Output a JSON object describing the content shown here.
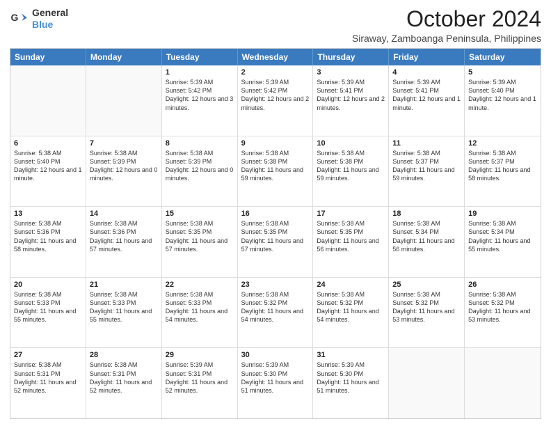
{
  "header": {
    "logo": {
      "general": "General",
      "blue": "Blue"
    },
    "month": "October 2024",
    "subtitle": "Siraway, Zamboanga Peninsula, Philippines"
  },
  "weekdays": [
    "Sunday",
    "Monday",
    "Tuesday",
    "Wednesday",
    "Thursday",
    "Friday",
    "Saturday"
  ],
  "rows": [
    [
      {
        "day": "",
        "sunrise": "",
        "sunset": "",
        "daylight": ""
      },
      {
        "day": "",
        "sunrise": "",
        "sunset": "",
        "daylight": ""
      },
      {
        "day": "1",
        "sunrise": "Sunrise: 5:39 AM",
        "sunset": "Sunset: 5:42 PM",
        "daylight": "Daylight: 12 hours and 3 minutes."
      },
      {
        "day": "2",
        "sunrise": "Sunrise: 5:39 AM",
        "sunset": "Sunset: 5:42 PM",
        "daylight": "Daylight: 12 hours and 2 minutes."
      },
      {
        "day": "3",
        "sunrise": "Sunrise: 5:39 AM",
        "sunset": "Sunset: 5:41 PM",
        "daylight": "Daylight: 12 hours and 2 minutes."
      },
      {
        "day": "4",
        "sunrise": "Sunrise: 5:39 AM",
        "sunset": "Sunset: 5:41 PM",
        "daylight": "Daylight: 12 hours and 1 minute."
      },
      {
        "day": "5",
        "sunrise": "Sunrise: 5:39 AM",
        "sunset": "Sunset: 5:40 PM",
        "daylight": "Daylight: 12 hours and 1 minute."
      }
    ],
    [
      {
        "day": "6",
        "sunrise": "Sunrise: 5:38 AM",
        "sunset": "Sunset: 5:40 PM",
        "daylight": "Daylight: 12 hours and 1 minute."
      },
      {
        "day": "7",
        "sunrise": "Sunrise: 5:38 AM",
        "sunset": "Sunset: 5:39 PM",
        "daylight": "Daylight: 12 hours and 0 minutes."
      },
      {
        "day": "8",
        "sunrise": "Sunrise: 5:38 AM",
        "sunset": "Sunset: 5:39 PM",
        "daylight": "Daylight: 12 hours and 0 minutes."
      },
      {
        "day": "9",
        "sunrise": "Sunrise: 5:38 AM",
        "sunset": "Sunset: 5:38 PM",
        "daylight": "Daylight: 11 hours and 59 minutes."
      },
      {
        "day": "10",
        "sunrise": "Sunrise: 5:38 AM",
        "sunset": "Sunset: 5:38 PM",
        "daylight": "Daylight: 11 hours and 59 minutes."
      },
      {
        "day": "11",
        "sunrise": "Sunrise: 5:38 AM",
        "sunset": "Sunset: 5:37 PM",
        "daylight": "Daylight: 11 hours and 59 minutes."
      },
      {
        "day": "12",
        "sunrise": "Sunrise: 5:38 AM",
        "sunset": "Sunset: 5:37 PM",
        "daylight": "Daylight: 11 hours and 58 minutes."
      }
    ],
    [
      {
        "day": "13",
        "sunrise": "Sunrise: 5:38 AM",
        "sunset": "Sunset: 5:36 PM",
        "daylight": "Daylight: 11 hours and 58 minutes."
      },
      {
        "day": "14",
        "sunrise": "Sunrise: 5:38 AM",
        "sunset": "Sunset: 5:36 PM",
        "daylight": "Daylight: 11 hours and 57 minutes."
      },
      {
        "day": "15",
        "sunrise": "Sunrise: 5:38 AM",
        "sunset": "Sunset: 5:35 PM",
        "daylight": "Daylight: 11 hours and 57 minutes."
      },
      {
        "day": "16",
        "sunrise": "Sunrise: 5:38 AM",
        "sunset": "Sunset: 5:35 PM",
        "daylight": "Daylight: 11 hours and 57 minutes."
      },
      {
        "day": "17",
        "sunrise": "Sunrise: 5:38 AM",
        "sunset": "Sunset: 5:35 PM",
        "daylight": "Daylight: 11 hours and 56 minutes."
      },
      {
        "day": "18",
        "sunrise": "Sunrise: 5:38 AM",
        "sunset": "Sunset: 5:34 PM",
        "daylight": "Daylight: 11 hours and 56 minutes."
      },
      {
        "day": "19",
        "sunrise": "Sunrise: 5:38 AM",
        "sunset": "Sunset: 5:34 PM",
        "daylight": "Daylight: 11 hours and 55 minutes."
      }
    ],
    [
      {
        "day": "20",
        "sunrise": "Sunrise: 5:38 AM",
        "sunset": "Sunset: 5:33 PM",
        "daylight": "Daylight: 11 hours and 55 minutes."
      },
      {
        "day": "21",
        "sunrise": "Sunrise: 5:38 AM",
        "sunset": "Sunset: 5:33 PM",
        "daylight": "Daylight: 11 hours and 55 minutes."
      },
      {
        "day": "22",
        "sunrise": "Sunrise: 5:38 AM",
        "sunset": "Sunset: 5:33 PM",
        "daylight": "Daylight: 11 hours and 54 minutes."
      },
      {
        "day": "23",
        "sunrise": "Sunrise: 5:38 AM",
        "sunset": "Sunset: 5:32 PM",
        "daylight": "Daylight: 11 hours and 54 minutes."
      },
      {
        "day": "24",
        "sunrise": "Sunrise: 5:38 AM",
        "sunset": "Sunset: 5:32 PM",
        "daylight": "Daylight: 11 hours and 54 minutes."
      },
      {
        "day": "25",
        "sunrise": "Sunrise: 5:38 AM",
        "sunset": "Sunset: 5:32 PM",
        "daylight": "Daylight: 11 hours and 53 minutes."
      },
      {
        "day": "26",
        "sunrise": "Sunrise: 5:38 AM",
        "sunset": "Sunset: 5:32 PM",
        "daylight": "Daylight: 11 hours and 53 minutes."
      }
    ],
    [
      {
        "day": "27",
        "sunrise": "Sunrise: 5:38 AM",
        "sunset": "Sunset: 5:31 PM",
        "daylight": "Daylight: 11 hours and 52 minutes."
      },
      {
        "day": "28",
        "sunrise": "Sunrise: 5:38 AM",
        "sunset": "Sunset: 5:31 PM",
        "daylight": "Daylight: 11 hours and 52 minutes."
      },
      {
        "day": "29",
        "sunrise": "Sunrise: 5:39 AM",
        "sunset": "Sunset: 5:31 PM",
        "daylight": "Daylight: 11 hours and 52 minutes."
      },
      {
        "day": "30",
        "sunrise": "Sunrise: 5:39 AM",
        "sunset": "Sunset: 5:30 PM",
        "daylight": "Daylight: 11 hours and 51 minutes."
      },
      {
        "day": "31",
        "sunrise": "Sunrise: 5:39 AM",
        "sunset": "Sunset: 5:30 PM",
        "daylight": "Daylight: 11 hours and 51 minutes."
      },
      {
        "day": "",
        "sunrise": "",
        "sunset": "",
        "daylight": ""
      },
      {
        "day": "",
        "sunrise": "",
        "sunset": "",
        "daylight": ""
      }
    ]
  ]
}
